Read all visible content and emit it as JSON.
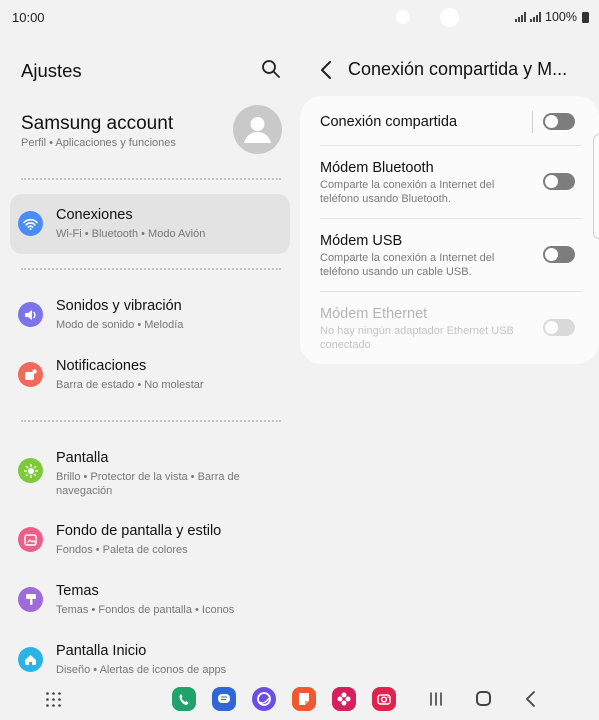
{
  "status_bar": {
    "time": "10:00",
    "battery": "100%"
  },
  "left": {
    "title": "Ajustes",
    "account": {
      "name": "Samsung account",
      "subtitle": "Perfil • Aplicaciones y funciones"
    },
    "items": [
      {
        "title": "Conexiones",
        "subtitle": "Wi-Fi • Bluetooth • Modo Avión",
        "icon": "wifi-icon",
        "color": "#4a8df6",
        "selected": true
      },
      {
        "title": "Sonidos y vibración",
        "subtitle": "Modo de sonido • Melodía",
        "icon": "speaker-icon",
        "color": "#7d73ea"
      },
      {
        "title": "Notificaciones",
        "subtitle": "Barra de estado • No molestar",
        "icon": "notification-icon",
        "color": "#f06b5c"
      },
      {
        "title": "Pantalla",
        "subtitle": "Brillo • Protector de la vista • Barra de navegación",
        "icon": "sun-icon",
        "color": "#7cc93a"
      },
      {
        "title": "Fondo de pantalla y estilo",
        "subtitle": "Fondos • Paleta de colores",
        "icon": "picture-icon",
        "color": "#ee5e88"
      },
      {
        "title": "Temas",
        "subtitle": "Temas • Fondos de pantalla • Iconos",
        "icon": "theme-brush-icon",
        "color": "#a069dc"
      },
      {
        "title": "Pantalla Inicio",
        "subtitle": "Diseño • Alertas de iconos de apps",
        "icon": "home-icon",
        "color": "#2ab3e5"
      }
    ]
  },
  "right": {
    "title": "Conexión compartida y M...",
    "rows": [
      {
        "title": "Conexión compartida",
        "subtitle": "",
        "enabled": true,
        "on": false
      },
      {
        "title": "Módem Bluetooth",
        "subtitle": "Comparte la conexión a Internet del teléfono usando Bluetooth.",
        "enabled": true,
        "on": false
      },
      {
        "title": "Módem USB",
        "subtitle": "Comparte la conexión a Internet del teléfono usando un cable USB.",
        "enabled": true,
        "on": false
      },
      {
        "title": "Módem Ethernet",
        "subtitle": "No hay ningún adaptador Ethernet USB conectado",
        "enabled": false,
        "on": false
      }
    ]
  },
  "dock": [
    {
      "name": "phone-app",
      "color": "#1fa36b"
    },
    {
      "name": "messages-app",
      "color": "#2f67d8"
    },
    {
      "name": "internet-app",
      "color": "#6a4ee6"
    },
    {
      "name": "notes-app",
      "color": "#f0582f"
    },
    {
      "name": "gallery-app",
      "color": "#d81f5d"
    },
    {
      "name": "camera-app",
      "color": "#e0234d"
    }
  ]
}
